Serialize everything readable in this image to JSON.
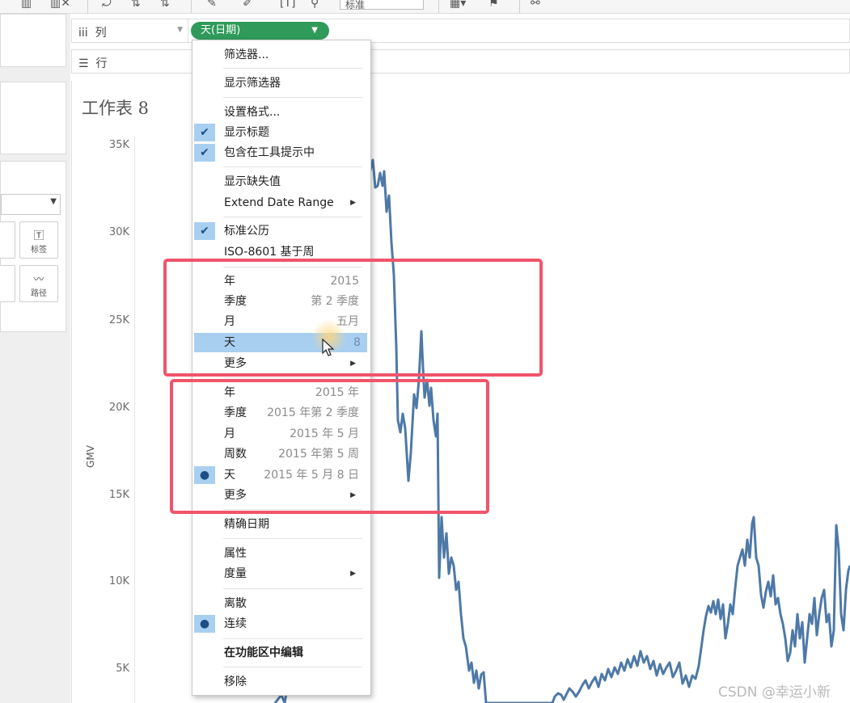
{
  "toolbar": {
    "zoom_value": "标准"
  },
  "shelves": {
    "columns_label": "列",
    "rows_label": "行",
    "pill_label": "天(日期)"
  },
  "marks": {
    "label_btn": "标签",
    "path_btn": "路径",
    "btn_a_fragment": "ㅅ",
    "btn_b_fragment": "示"
  },
  "sheet": {
    "title": "工作表 8",
    "y_axis_label": "GMV",
    "y_ticks": [
      "35K",
      "30K",
      "25K",
      "20K",
      "15K",
      "10K",
      "5K"
    ]
  },
  "menu": {
    "filter": "筛选器...",
    "show_filter": "显示筛选器",
    "format": "设置格式...",
    "show_header": "显示标题",
    "include_tooltip": "包含在工具提示中",
    "show_missing": "显示缺失值",
    "extend_date_range": "Extend Date Range",
    "standard_calendar": "标准公历",
    "iso_week": "ISO-8601 基于周",
    "part": [
      {
        "label": "年",
        "value": "2015"
      },
      {
        "label": "季度",
        "value": "第 2 季度"
      },
      {
        "label": "月",
        "value": "五月"
      },
      {
        "label": "天",
        "value": "8"
      },
      {
        "label": "更多",
        "value": ""
      }
    ],
    "exact": [
      {
        "label": "年",
        "value": "2015 年"
      },
      {
        "label": "季度",
        "value": "2015 年第 2 季度"
      },
      {
        "label": "月",
        "value": "2015 年 5 月"
      },
      {
        "label": "周数",
        "value": "2015 年第 5 周"
      },
      {
        "label": "天",
        "value": "2015 年 5 月 8 日"
      },
      {
        "label": "更多",
        "value": ""
      }
    ],
    "exact_date": "精确日期",
    "attribute": "属性",
    "measure": "度量",
    "discrete": "离散",
    "continuous": "连续",
    "edit_in_shelf": "在功能区中编辑",
    "remove": "移除"
  },
  "watermark": "CSDN @幸运小新"
}
